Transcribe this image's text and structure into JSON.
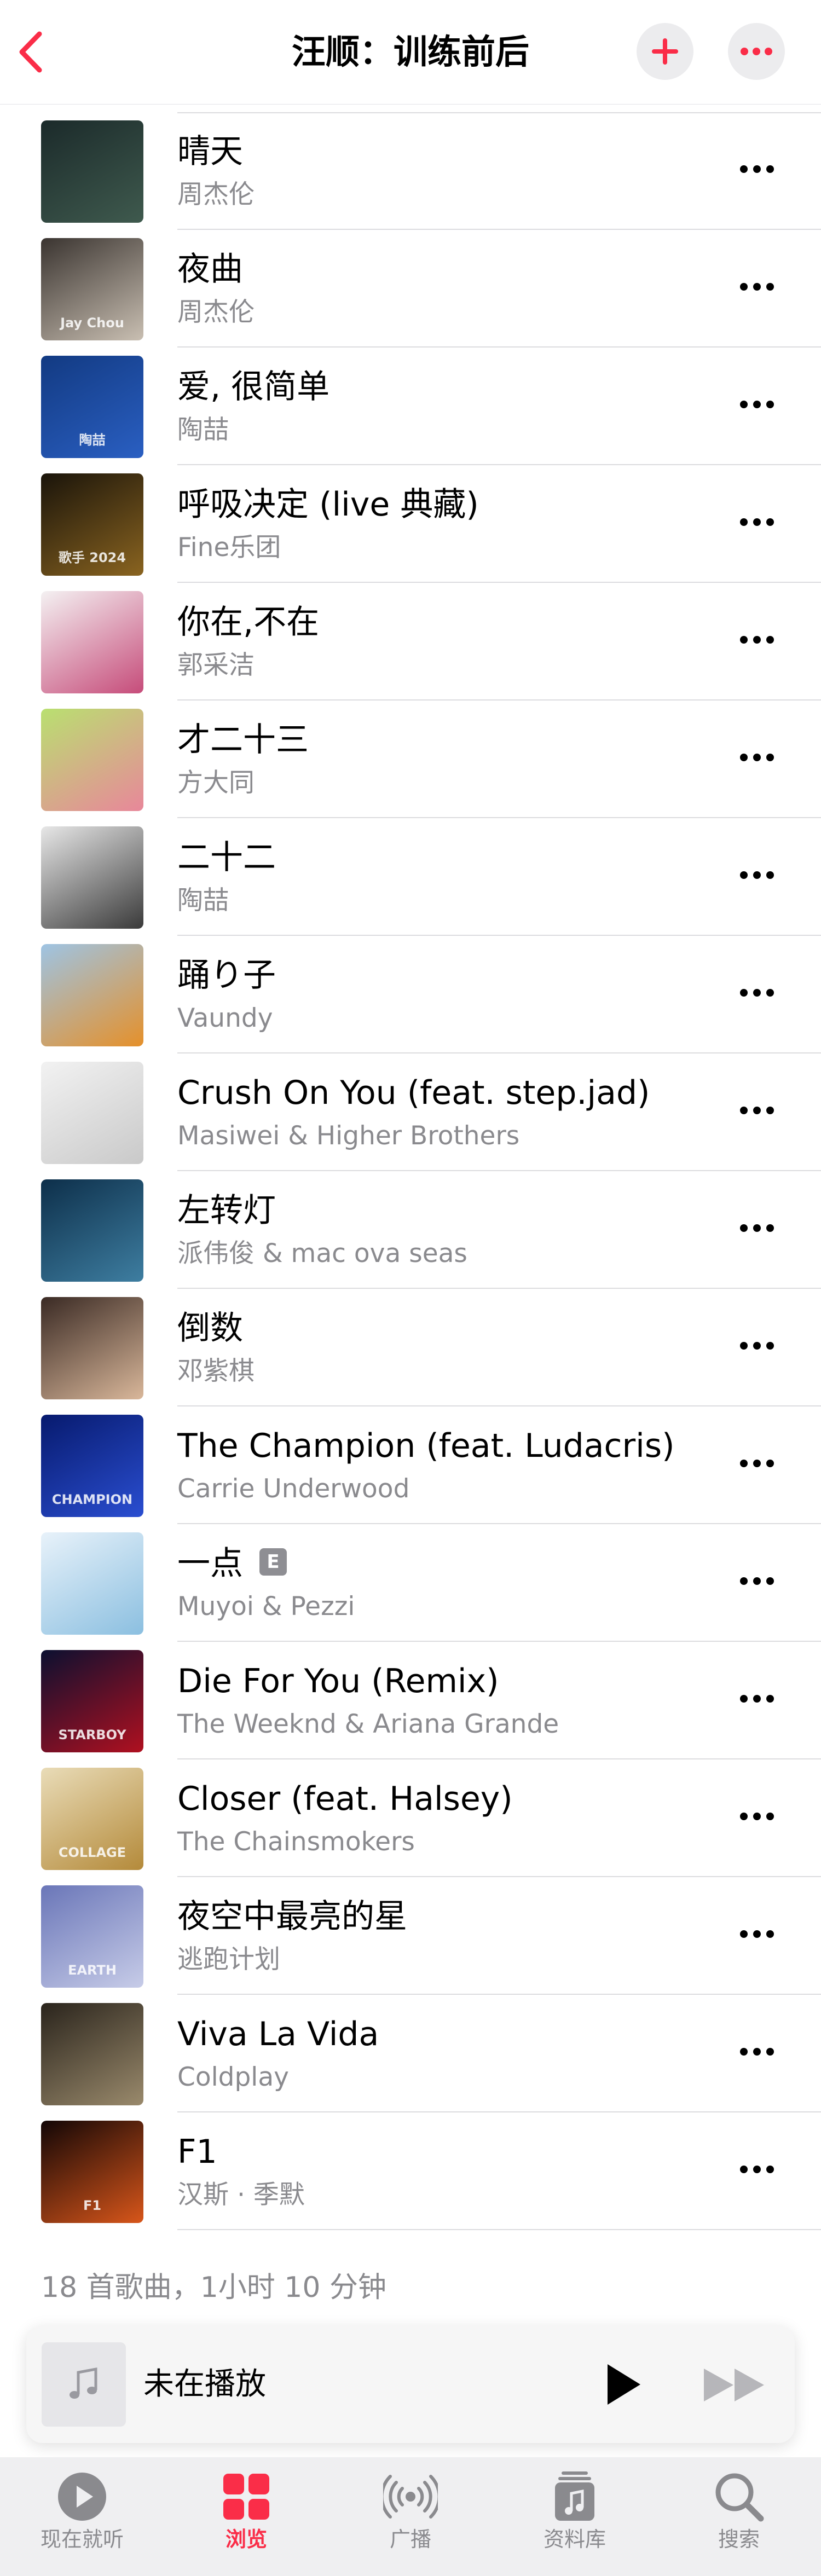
{
  "header": {
    "title": "汪顺：训练前后",
    "back_icon": "chevron-left-icon",
    "add_icon": "plus-icon",
    "more_icon": "ellipsis-icon"
  },
  "colors": {
    "accent": "#fa2d48",
    "secondary_text": "#8a8a8e"
  },
  "songs": [
    {
      "title": "晴天",
      "artist": "周杰伦",
      "explicit": false,
      "art_colors": [
        "#1b2a2a",
        "#3f5a4e"
      ],
      "art_label": ""
    },
    {
      "title": "夜曲",
      "artist": "周杰伦",
      "explicit": false,
      "art_colors": [
        "#3a3430",
        "#c9bfb2"
      ],
      "art_label": "Jay Chou"
    },
    {
      "title": "爱, 很简单",
      "artist": "陶喆",
      "explicit": false,
      "art_colors": [
        "#123a82",
        "#2a5fc2"
      ],
      "art_label": "陶喆"
    },
    {
      "title": "呼吸决定 (live 典藏)",
      "artist": "Fine乐团",
      "explicit": false,
      "art_colors": [
        "#1a140a",
        "#8a6420"
      ],
      "art_label": "歌手 2024"
    },
    {
      "title": "你在,不在",
      "artist": "郭采洁",
      "explicit": false,
      "art_colors": [
        "#f4f1f2",
        "#c64c7a"
      ],
      "art_label": ""
    },
    {
      "title": "才二十三",
      "artist": "方大同",
      "explicit": false,
      "art_colors": [
        "#b9e070",
        "#e8879a"
      ],
      "art_label": ""
    },
    {
      "title": "二十二",
      "artist": "陶喆",
      "explicit": false,
      "art_colors": [
        "#e7e7e7",
        "#3a3a3a"
      ],
      "art_label": ""
    },
    {
      "title": "踊り子",
      "artist": "Vaundy",
      "explicit": false,
      "art_colors": [
        "#9ec4e4",
        "#e5902a"
      ],
      "art_label": ""
    },
    {
      "title": "Crush On You (feat. step.jad)",
      "artist": "Masiwei & Higher Brothers",
      "explicit": false,
      "art_colors": [
        "#f2f2f2",
        "#c9c9c9"
      ],
      "art_label": ""
    },
    {
      "title": "左转灯",
      "artist": "派伟俊 & mac ova seas",
      "explicit": false,
      "art_colors": [
        "#0d2f4a",
        "#3e7ea1"
      ],
      "art_label": ""
    },
    {
      "title": "倒数",
      "artist": "邓紫棋",
      "explicit": false,
      "art_colors": [
        "#3a2a24",
        "#d9b79a"
      ],
      "art_label": ""
    },
    {
      "title": "The Champion (feat. Ludacris)",
      "artist": "Carrie Underwood",
      "explicit": false,
      "art_colors": [
        "#071a6e",
        "#2a4ed1"
      ],
      "art_label": "CHAMPION"
    },
    {
      "title": "一点",
      "artist": "Muyoi & Pezzi",
      "explicit": true,
      "explicit_label": "E",
      "art_colors": [
        "#e8f2fa",
        "#8bbfe0"
      ],
      "art_label": ""
    },
    {
      "title": "Die For You (Remix)",
      "artist": "The Weeknd & Ariana Grande",
      "explicit": false,
      "art_colors": [
        "#0b1030",
        "#b01020"
      ],
      "art_label": "STARBOY"
    },
    {
      "title": "Closer (feat. Halsey)",
      "artist": "The Chainsmokers",
      "explicit": false,
      "art_colors": [
        "#e9dcb8",
        "#b48a3a"
      ],
      "art_label": "COLLAGE"
    },
    {
      "title": "夜空中最亮的星",
      "artist": "逃跑计划",
      "explicit": false,
      "art_colors": [
        "#6a76b8",
        "#c7cce8"
      ],
      "art_label": "EARTH"
    },
    {
      "title": "Viva La Vida",
      "artist": "Coldplay",
      "explicit": false,
      "art_colors": [
        "#2a241c",
        "#9a8a6c"
      ],
      "art_label": ""
    },
    {
      "title": "F1",
      "artist": "汉斯 · 季默",
      "explicit": false,
      "art_colors": [
        "#120606",
        "#d8561a"
      ],
      "art_label": "F1"
    }
  ],
  "summary": "18 首歌曲，1小时 10 分钟",
  "mini_player": {
    "title": "未在播放",
    "art_icon": "music-note-icon",
    "play_icon": "play-icon",
    "forward_icon": "fast-forward-icon"
  },
  "tabs": [
    {
      "label": "现在就听",
      "icon": "play-circle-icon",
      "active": false
    },
    {
      "label": "浏览",
      "icon": "grid-icon",
      "active": true
    },
    {
      "label": "广播",
      "icon": "broadcast-icon",
      "active": false
    },
    {
      "label": "资料库",
      "icon": "library-icon",
      "active": false
    },
    {
      "label": "搜索",
      "icon": "search-icon",
      "active": false
    }
  ]
}
